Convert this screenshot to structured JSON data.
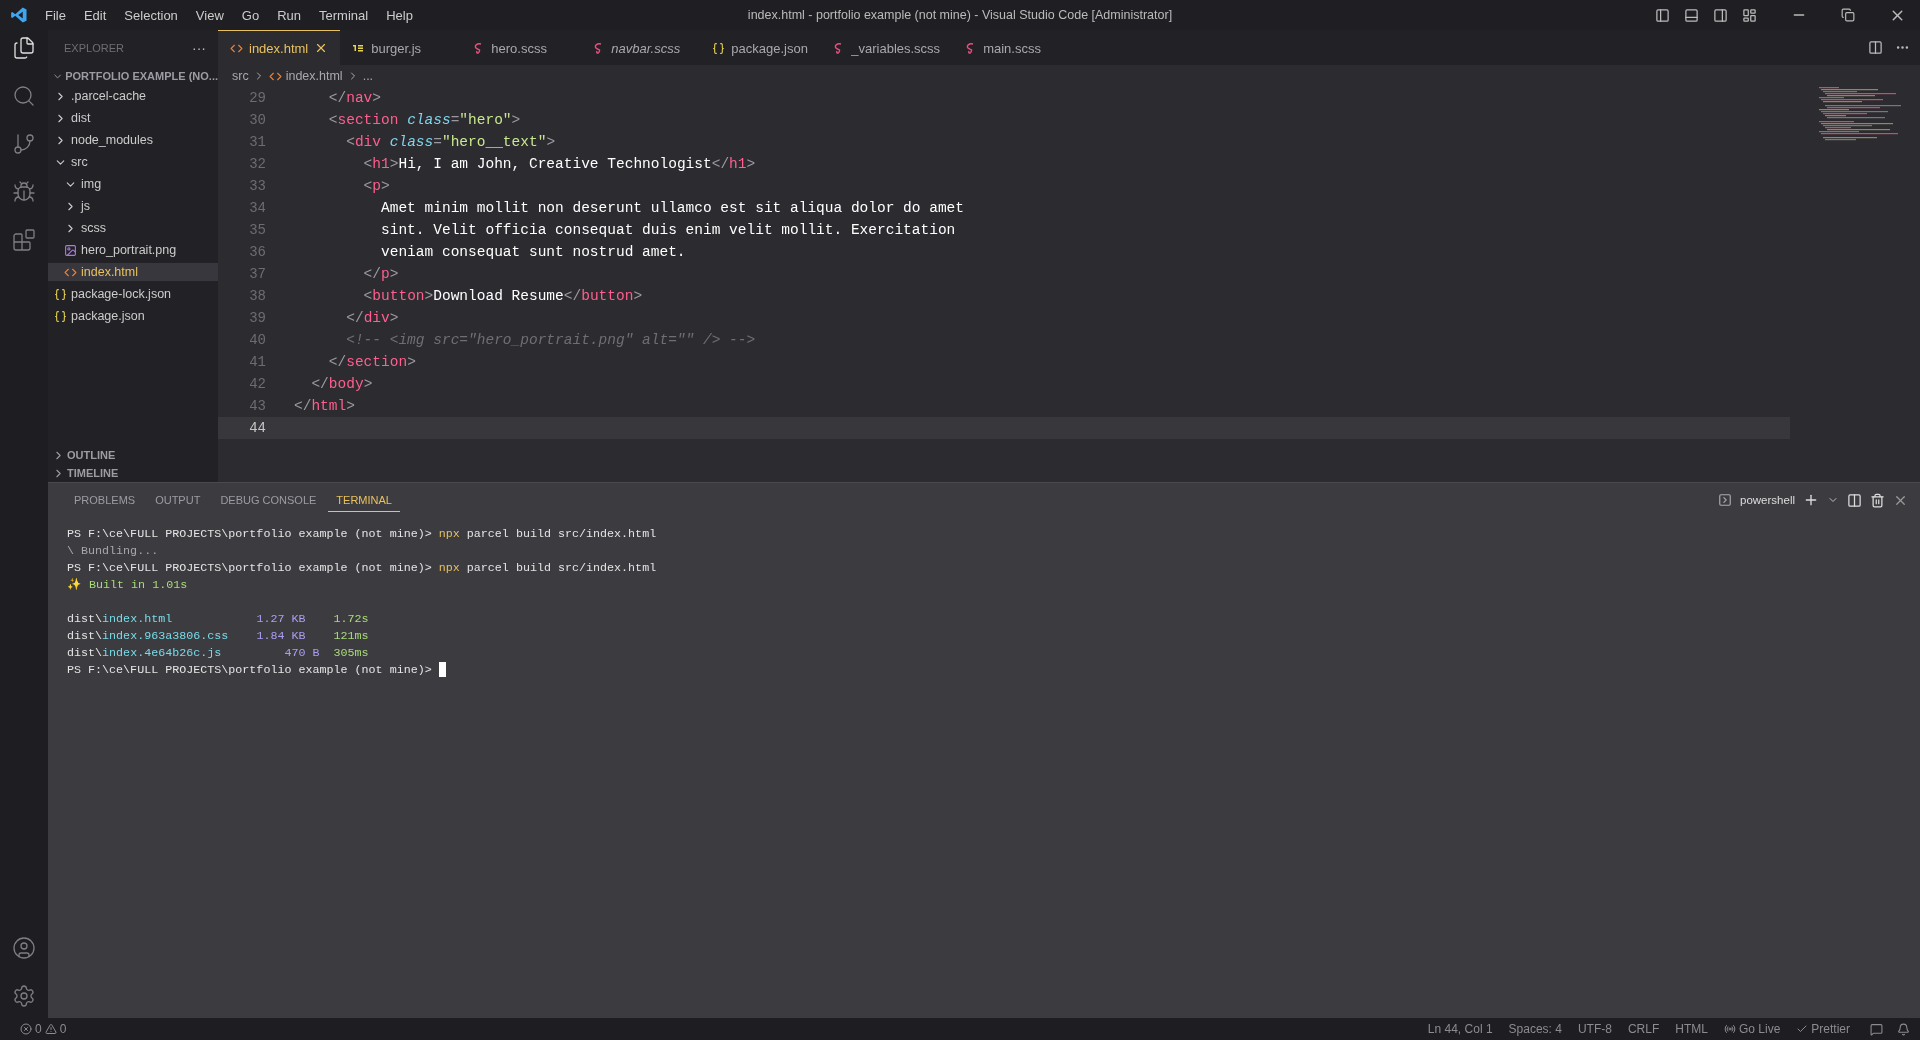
{
  "menu": [
    "File",
    "Edit",
    "Selection",
    "View",
    "Go",
    "Run",
    "Terminal",
    "Help"
  ],
  "window": {
    "title": "index.html - portfolio example (not mine) - Visual Studio Code [Administrator]"
  },
  "activity_bar": [
    {
      "kind": "files",
      "selected": true
    },
    {
      "kind": "search",
      "selected": false
    },
    {
      "kind": "git",
      "selected": false
    },
    {
      "kind": "debug",
      "selected": false
    },
    {
      "kind": "extensions",
      "selected": false
    }
  ],
  "sidebar": {
    "title": "EXPLORER",
    "menu": "···",
    "project": "PORTFOLIO EXAMPLE (NO...",
    "tree": [
      {
        "label": ".parcel-cache",
        "kind": "folder",
        "expanded": false,
        "selected": false
      },
      {
        "label": "dist",
        "kind": "folder",
        "expanded": false,
        "selected": false
      },
      {
        "label": "node_modules",
        "kind": "folder",
        "expanded": false,
        "selected": false
      },
      {
        "label": "src",
        "kind": "folder",
        "expanded": true,
        "selected": false,
        "children": [
          {
            "label": "img",
            "kind": "folder",
            "expanded": true,
            "selected": false
          },
          {
            "label": "js",
            "kind": "folder",
            "expanded": false,
            "selected": false
          },
          {
            "label": "scss",
            "kind": "folder",
            "expanded": false,
            "selected": false
          },
          {
            "label": "hero_portrait.png",
            "kind": "image",
            "selected": false
          },
          {
            "label": "index.html",
            "kind": "html",
            "selected": true
          }
        ]
      },
      {
        "label": "package-lock.json",
        "kind": "json",
        "selected": false
      },
      {
        "label": "package.json",
        "kind": "json",
        "selected": false
      }
    ],
    "sections": [
      "OUTLINE",
      "TIMELINE"
    ]
  },
  "tabs": [
    {
      "label": "index.html",
      "kind": "html",
      "selected": true,
      "italic": false
    },
    {
      "label": "burger.js",
      "kind": "js",
      "selected": false,
      "italic": false
    },
    {
      "label": "hero.scss",
      "kind": "scss",
      "selected": false,
      "italic": false
    },
    {
      "label": "navbar.scss",
      "kind": "scss",
      "selected": false,
      "italic": true
    },
    {
      "label": "package.json",
      "kind": "json",
      "selected": false,
      "italic": false
    },
    {
      "label": "_variables.scss",
      "kind": "scss",
      "selected": false,
      "italic": false
    },
    {
      "label": "main.scss",
      "kind": "scss",
      "selected": false,
      "italic": false
    }
  ],
  "breadcrumb": [
    "src",
    "index.html",
    "..."
  ],
  "code": [
    {
      "number": "29",
      "current": false,
      "tokens": [
        {
          "kind": "punct",
          "text": "    </"
        },
        {
          "kind": "tag",
          "text": "nav"
        },
        {
          "kind": "punct",
          "text": ">"
        }
      ]
    },
    {
      "number": "30",
      "current": false,
      "tokens": [
        {
          "kind": "punct",
          "text": "    <"
        },
        {
          "kind": "tag",
          "text": "section"
        },
        {
          "kind": "attr",
          "text": " class"
        },
        {
          "kind": "punct",
          "text": "="
        },
        {
          "kind": "string",
          "text": "\"hero\""
        },
        {
          "kind": "punct",
          "text": ">"
        }
      ]
    },
    {
      "number": "31",
      "current": false,
      "tokens": [
        {
          "kind": "punct",
          "text": "      <"
        },
        {
          "kind": "tag",
          "text": "div"
        },
        {
          "kind": "attr",
          "text": " class"
        },
        {
          "kind": "punct",
          "text": "="
        },
        {
          "kind": "string",
          "text": "\"hero__text\""
        },
        {
          "kind": "punct",
          "text": ">"
        }
      ]
    },
    {
      "number": "32",
      "current": false,
      "tokens": [
        {
          "kind": "punct",
          "text": "        <"
        },
        {
          "kind": "tag",
          "text": "h1"
        },
        {
          "kind": "punct",
          "text": ">"
        },
        {
          "kind": "text",
          "text": "Hi, I am John, Creative Technologist"
        },
        {
          "kind": "punct",
          "text": "</"
        },
        {
          "kind": "tag",
          "text": "h1"
        },
        {
          "kind": "punct",
          "text": ">"
        }
      ]
    },
    {
      "number": "33",
      "current": false,
      "tokens": [
        {
          "kind": "punct",
          "text": "        <"
        },
        {
          "kind": "tag",
          "text": "p"
        },
        {
          "kind": "punct",
          "text": ">"
        }
      ]
    },
    {
      "number": "34",
      "current": false,
      "tokens": [
        {
          "kind": "text",
          "text": "          Amet minim mollit non deserunt ullamco est sit aliqua dolor do amet"
        }
      ]
    },
    {
      "number": "35",
      "current": false,
      "tokens": [
        {
          "kind": "text",
          "text": "          sint. Velit officia consequat duis enim velit mollit. Exercitation"
        }
      ]
    },
    {
      "number": "36",
      "current": false,
      "tokens": [
        {
          "kind": "text",
          "text": "          veniam consequat sunt nostrud amet."
        }
      ]
    },
    {
      "number": "37",
      "current": false,
      "tokens": [
        {
          "kind": "punct",
          "text": "        </"
        },
        {
          "kind": "tag",
          "text": "p"
        },
        {
          "kind": "punct",
          "text": ">"
        }
      ]
    },
    {
      "number": "38",
      "current": false,
      "tokens": [
        {
          "kind": "punct",
          "text": "        <"
        },
        {
          "kind": "tag",
          "text": "button"
        },
        {
          "kind": "punct",
          "text": ">"
        },
        {
          "kind": "text",
          "text": "Download Resume"
        },
        {
          "kind": "punct",
          "text": "</"
        },
        {
          "kind": "tag",
          "text": "button"
        },
        {
          "kind": "punct",
          "text": ">"
        }
      ]
    },
    {
      "number": "39",
      "current": false,
      "tokens": [
        {
          "kind": "punct",
          "text": "      </"
        },
        {
          "kind": "tag",
          "text": "div"
        },
        {
          "kind": "punct",
          "text": ">"
        }
      ]
    },
    {
      "number": "40",
      "current": false,
      "tokens": [
        {
          "kind": "comment",
          "text": "      <!-- <img src=\"hero_portrait.png\" alt=\"\" /> -->"
        }
      ]
    },
    {
      "number": "41",
      "current": false,
      "tokens": [
        {
          "kind": "punct",
          "text": "    </"
        },
        {
          "kind": "tag",
          "text": "section"
        },
        {
          "kind": "punct",
          "text": ">"
        }
      ]
    },
    {
      "number": "42",
      "current": false,
      "tokens": [
        {
          "kind": "punct",
          "text": "  </"
        },
        {
          "kind": "tag",
          "text": "body"
        },
        {
          "kind": "punct",
          "text": ">"
        }
      ]
    },
    {
      "number": "43",
      "current": false,
      "tokens": [
        {
          "kind": "punct",
          "text": "</"
        },
        {
          "kind": "tag",
          "text": "html"
        },
        {
          "kind": "punct",
          "text": ">"
        }
      ]
    },
    {
      "number": "44",
      "current": true
    }
  ],
  "panel": {
    "tabs": [
      {
        "label": "PROBLEMS",
        "selected": false
      },
      {
        "label": "OUTPUT",
        "selected": false
      },
      {
        "label": "DEBUG CONSOLE",
        "selected": false
      },
      {
        "label": "TERMINAL",
        "selected": true
      }
    ],
    "shell": "powershell",
    "terminal_blocks": [
      [
        {
          "cursor": false,
          "tokens": [
            {
              "kind": "plain",
              "text": "PS F:\\ce\\FULL PROJECTS\\portfolio example (not mine)> "
            },
            {
              "kind": "command",
              "text": "npx"
            },
            {
              "kind": "plain",
              "text": " parcel build src/index.html"
            }
          ]
        },
        {
          "cursor": false,
          "tokens": [
            {
              "kind": "dim",
              "text": "\\ Bundling..."
            }
          ]
        },
        {
          "cursor": false,
          "tokens": [
            {
              "kind": "plain",
              "text": "PS F:\\ce\\FULL PROJECTS\\portfolio example (not mine)> "
            },
            {
              "kind": "command",
              "text": "npx"
            },
            {
              "kind": "plain",
              "text": " parcel build src/index.html"
            }
          ]
        },
        {
          "cursor": false,
          "tokens": [
            {
              "kind": "success",
              "text": "✨ Built in 1.01s"
            }
          ]
        }
      ],
      [
        {
          "cursor": false,
          "tokens": [
            {
              "kind": "plain",
              "text": "dist\\"
            },
            {
              "kind": "file",
              "text": "index.html"
            },
            {
              "kind": "size",
              "text": "            1.27 KB"
            },
            {
              "kind": "time",
              "text": "    1.72s"
            }
          ]
        },
        {
          "cursor": false,
          "tokens": [
            {
              "kind": "plain",
              "text": "dist\\"
            },
            {
              "kind": "file",
              "text": "index.963a3806.css"
            },
            {
              "kind": "size",
              "text": "    1.84 KB"
            },
            {
              "kind": "time",
              "text": "    121ms"
            }
          ]
        },
        {
          "cursor": false,
          "tokens": [
            {
              "kind": "plain",
              "text": "dist\\"
            },
            {
              "kind": "file",
              "text": "index.4e64b26c.js"
            },
            {
              "kind": "size",
              "text": "         470 B"
            },
            {
              "kind": "time",
              "text": "  305ms"
            }
          ]
        },
        {
          "cursor": true,
          "tokens": [
            {
              "kind": "plain",
              "text": "PS F:\\ce\\FULL PROJECTS\\portfolio example (not mine)> "
            }
          ]
        }
      ]
    ]
  },
  "status_bar": {
    "errors": "0",
    "warnings": "0",
    "items": [
      {
        "kind": "text",
        "label": "Ln 44, Col 1"
      },
      {
        "kind": "text",
        "label": "Spaces: 4"
      },
      {
        "kind": "text",
        "label": "UTF-8"
      },
      {
        "kind": "text",
        "label": "CRLF"
      },
      {
        "kind": "text",
        "label": "HTML"
      },
      {
        "kind": "live",
        "label": "Go Live"
      },
      {
        "kind": "check",
        "label": "Prettier"
      }
    ]
  }
}
